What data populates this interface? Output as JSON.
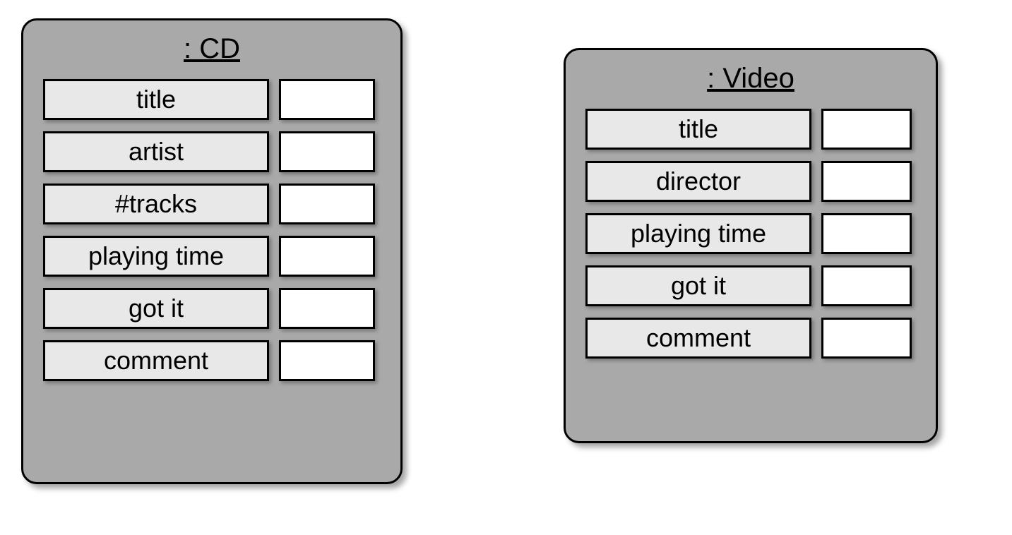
{
  "colors": {
    "box_fill": "#a9a9a9",
    "label_fill": "#e8e8e8",
    "value_fill": "#ffffff",
    "stroke": "#000000"
  },
  "cd": {
    "heading": ": CD",
    "fields": [
      {
        "label": "title",
        "value": ""
      },
      {
        "label": "artist",
        "value": ""
      },
      {
        "label": "#tracks",
        "value": ""
      },
      {
        "label": "playing time",
        "value": ""
      },
      {
        "label": "got it",
        "value": ""
      },
      {
        "label": "comment",
        "value": ""
      }
    ]
  },
  "video": {
    "heading": ": Video",
    "fields": [
      {
        "label": "title",
        "value": ""
      },
      {
        "label": "director",
        "value": ""
      },
      {
        "label": "playing time",
        "value": ""
      },
      {
        "label": "got it",
        "value": ""
      },
      {
        "label": "comment",
        "value": ""
      }
    ]
  }
}
